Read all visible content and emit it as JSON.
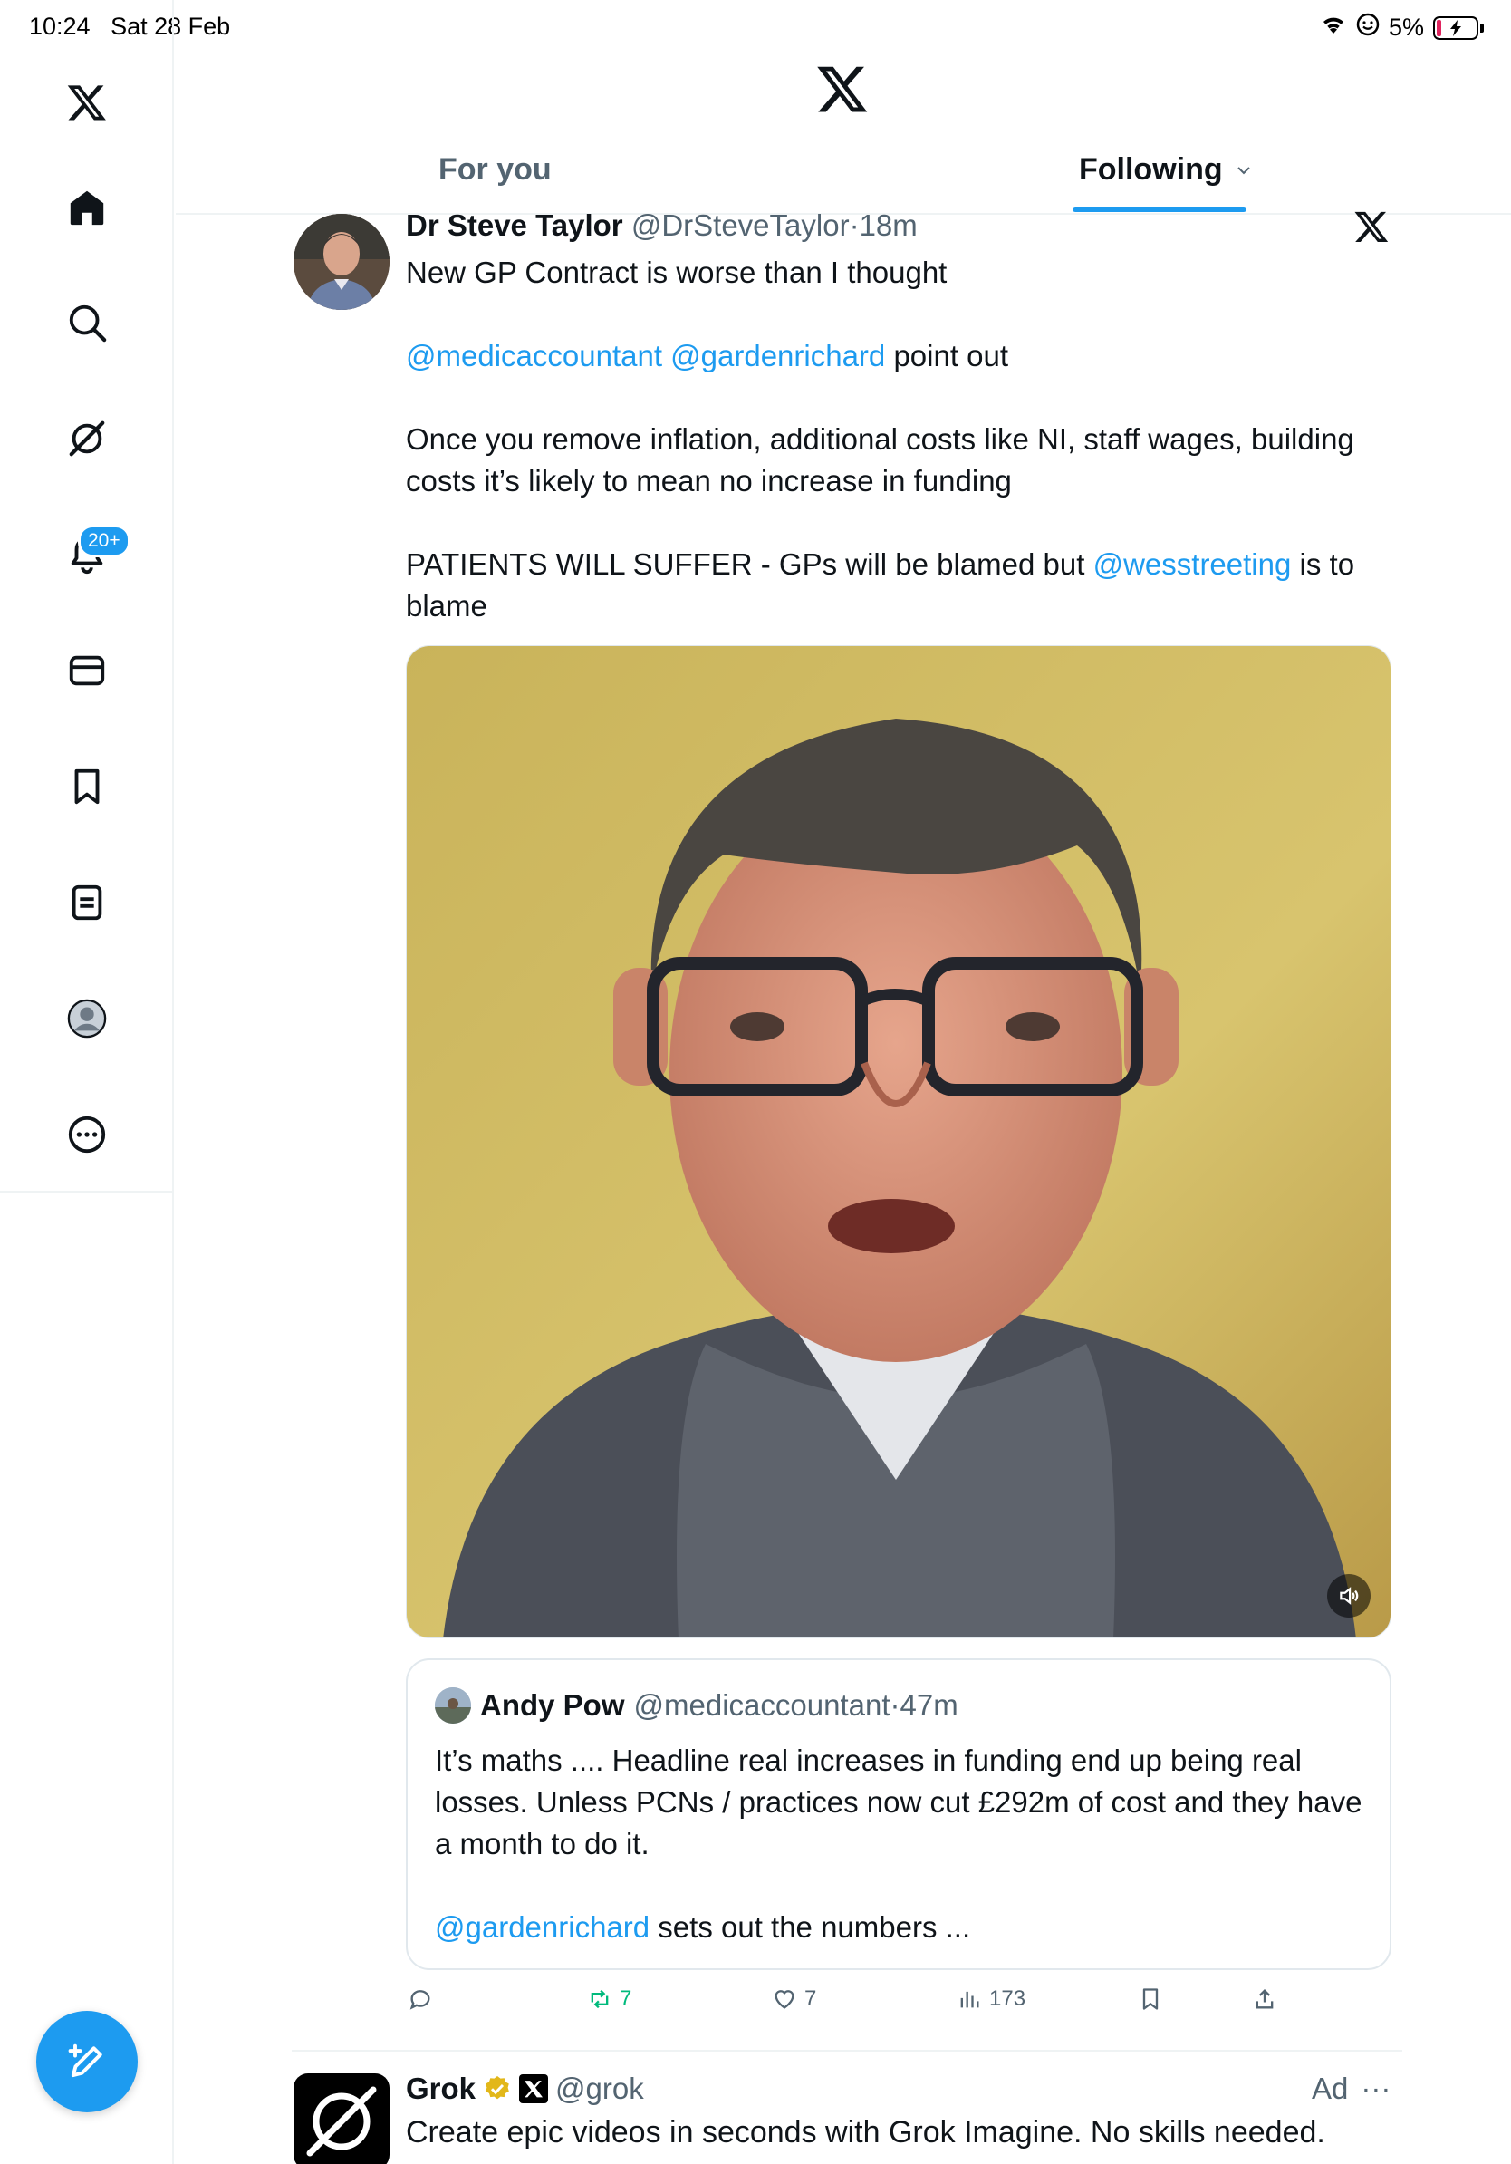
{
  "status_bar": {
    "time": "10:24",
    "date": "Sat 28 Feb",
    "battery": "5%"
  },
  "sidebar": {
    "notifications_badge": "20+"
  },
  "header": {
    "tabs": [
      {
        "label": "For you",
        "active": false
      },
      {
        "label": "Following",
        "active": true
      }
    ]
  },
  "tweet": {
    "author_name": "Dr Steve Taylor",
    "handle": "@DrSteveTaylor",
    "time": "18m",
    "line1": "New GP Contract is worse than I thought",
    "mention1": "@medicaccountant",
    "mention2": "@gardenrichard",
    "line2_tail": " point out",
    "line3": "Once you remove inflation, additional costs like NI, staff wages, building costs it’s likely to mean no increase in funding",
    "line4_head": "PATIENTS WILL SUFFER - GPs will be blamed but ",
    "mention3": "@wesstreeting",
    "line4_tail": " is to blame",
    "quote": {
      "author_name": "Andy Pow",
      "handle": "@medicaccountant",
      "time": "47m",
      "text": "It’s maths .... Headline real increases in funding end up being real losses. Unless PCNs / practices now cut £292m of cost and they have a month to do it.",
      "mention": "@gardenrichard",
      "text2": " sets out the numbers ..."
    },
    "actions": {
      "replies": "",
      "reposts": "7",
      "likes": "7",
      "views": "173"
    }
  },
  "ad": {
    "author_name": "Grok",
    "handle": "@grok",
    "label": "Ad",
    "more": "···",
    "text": "Create epic videos in seconds with Grok Imagine. No skills needed."
  },
  "colors": {
    "accent": "#1d9bf0",
    "repost": "#00ba7c",
    "muted": "#536471"
  }
}
